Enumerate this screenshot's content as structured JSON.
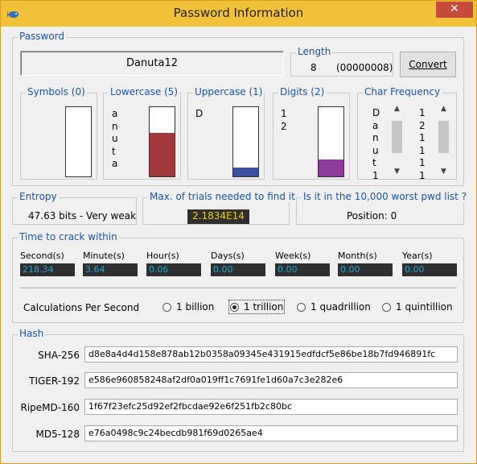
{
  "window": {
    "title": "Password Information",
    "close_glyph": "✕"
  },
  "password": {
    "group_label": "Password",
    "value": "Danuta12",
    "length_label": "Length",
    "length_value": "8",
    "length_hex": "(00000008)",
    "convert_label": "Convert"
  },
  "symbols": {
    "label": "Symbols (0)",
    "chars": [],
    "fill_fraction": 0,
    "color": "#ffffff"
  },
  "lowercase": {
    "label": "Lowercase (5)",
    "chars": [
      "a",
      "n",
      "u",
      "t",
      "a"
    ],
    "fill_fraction": 0.625,
    "color": "#a2373b"
  },
  "uppercase": {
    "label": "Uppercase (1)",
    "chars": [
      "D"
    ],
    "fill_fraction": 0.125,
    "color": "#3a4fa0"
  },
  "digits": {
    "label": "Digits (2)",
    "chars": [
      "1",
      "2"
    ],
    "fill_fraction": 0.25,
    "color": "#8e3c9c"
  },
  "char_frequency": {
    "label": "Char Frequency",
    "chars": [
      "D",
      "a",
      "n",
      "u",
      "t",
      "1"
    ],
    "counts": [
      "1",
      "2",
      "1",
      "1",
      "1",
      "1"
    ]
  },
  "entropy": {
    "label": "Entropy",
    "value": "47.63 bits - Very weak"
  },
  "max_trials": {
    "label": "Max. of trials needed to find it",
    "value": "2.1834E14"
  },
  "worst_list": {
    "label": "Is it in the 10,000 worst pwd list ?",
    "value": "Position: 0"
  },
  "crack": {
    "label": "Time to crack within",
    "columns": [
      {
        "label": "Second(s)",
        "value": "218.34"
      },
      {
        "label": "Minute(s)",
        "value": "3.64"
      },
      {
        "label": "Hour(s)",
        "value": "0.06"
      },
      {
        "label": "Days(s)",
        "value": "0.00"
      },
      {
        "label": "Week(s)",
        "value": "0.00"
      },
      {
        "label": "Month(s)",
        "value": "0.00"
      },
      {
        "label": "Year(s)",
        "value": "0.00"
      }
    ],
    "calc_label": "Calculations Per Second",
    "options": [
      {
        "label": "1 billion",
        "selected": false
      },
      {
        "label": "1 trillion",
        "selected": true
      },
      {
        "label": "1 quadrillion",
        "selected": false
      },
      {
        "label": "1 quintillion",
        "selected": false
      }
    ]
  },
  "hash": {
    "label": "Hash",
    "rows": [
      {
        "name": "SHA-256",
        "value": "d8e8a4d4d158e878ab12b0358a09345e431915edfdcf5e86be18b7fd946891fc"
      },
      {
        "name": "TIGER-192",
        "value": "e586e960858248af2df0a019ff1c7691fe1d60a7c3e282e6"
      },
      {
        "name": "RipeMD-160",
        "value": "1f67f23efc25d92ef2fbcdae92e6f251fb2c80bc"
      },
      {
        "name": "MD5-128",
        "value": "e76a0498c9c24becdb981f69d0265ae4"
      }
    ]
  }
}
